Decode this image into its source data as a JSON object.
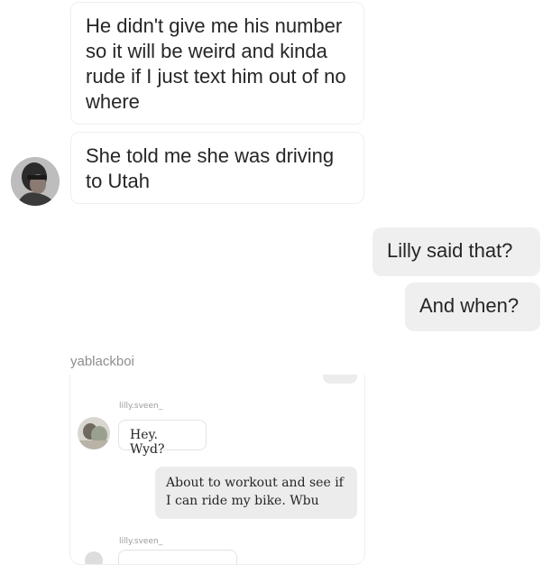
{
  "messages": {
    "incoming_1": "He didn't give me his number so it will be weird and kinda rude if I just text him out of no where",
    "incoming_2": "She told me she was driving to Utah",
    "outgoing_1": "Lilly said that?",
    "outgoing_2": "And when?"
  },
  "shared_post": {
    "sender": "yablackboi",
    "inner_chat": {
      "name_1": "lilly.sveen_",
      "message_in": "Hey. Wyd?",
      "message_out": "About to workout and see if I can ride my bike. Wbu",
      "name_2": "lilly.sveen_"
    }
  },
  "colors": {
    "incoming_bg": "#ffffff",
    "outgoing_bg": "#efefef",
    "text": "#262626",
    "muted": "#8e8e8e"
  }
}
